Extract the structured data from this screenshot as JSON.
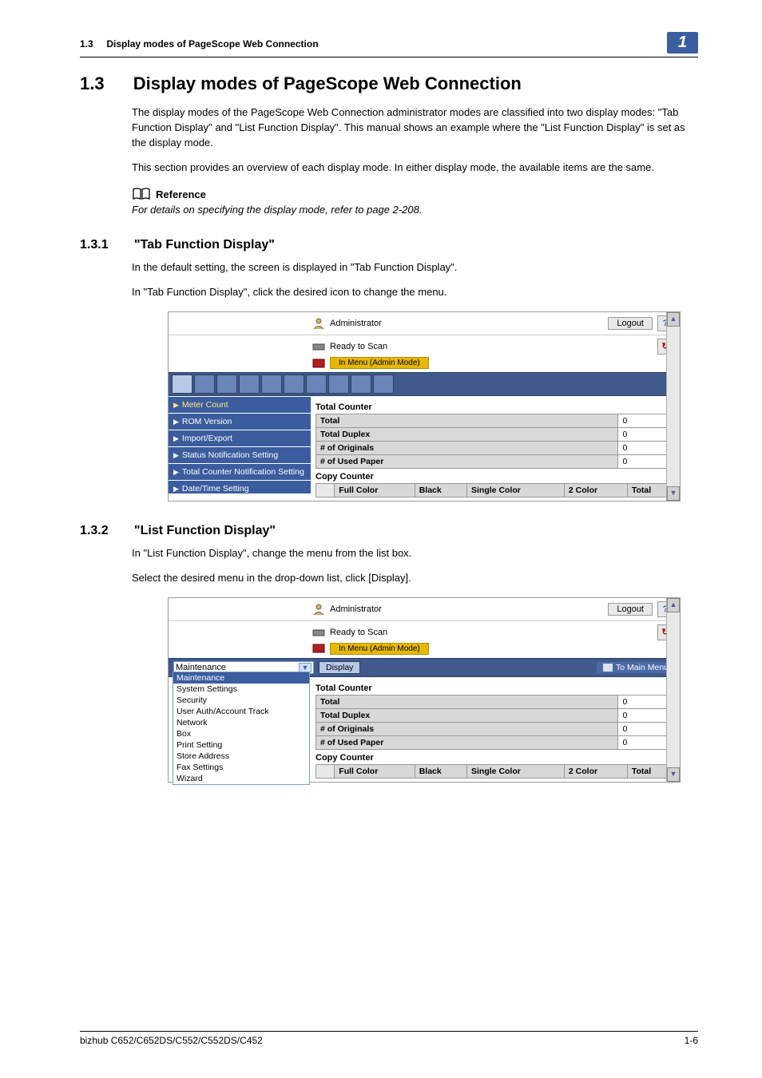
{
  "header": {
    "section_num_small": "1.3",
    "section_title_small": "Display modes of PageScope Web Connection",
    "chapter_badge": "1"
  },
  "section": {
    "num": "1.3",
    "title": "Display modes of PageScope Web Connection",
    "para1": "The display modes of the PageScope Web Connection administrator modes are classified into two display modes: \"Tab Function Display\" and \"List Function Display\". This manual shows an example where the \"List Function Display\" is set as the display mode.",
    "para2": "This section provides an overview of each display mode. In either display mode, the available items are the same.",
    "reference_label": "Reference",
    "reference_text": "For details on specifying the display mode, refer to page 2-208."
  },
  "sub1": {
    "num": "1.3.1",
    "title": "\"Tab Function Display\"",
    "p1": "In the default setting, the screen is displayed in \"Tab Function Display\".",
    "p2": "In \"Tab Function Display\", click the desired icon to change the menu."
  },
  "sub2": {
    "num": "1.3.2",
    "title": "\"List Function Display\"",
    "p1": "In \"List Function Display\", change the menu from the list box.",
    "p2": "Select the desired menu in the drop-down list, click [Display]."
  },
  "ss_common": {
    "admin_label": "Administrator",
    "logout": "Logout",
    "help": "?",
    "ready": "Ready to Scan",
    "in_menu": "In Menu (Admin Mode)",
    "refresh": "↻",
    "total_counter": "Total Counter",
    "rows": {
      "r1": {
        "label": "Total",
        "val": "0"
      },
      "r2": {
        "label": "Total Duplex",
        "val": "0"
      },
      "r3": {
        "label": "# of Originals",
        "val": "0"
      },
      "r4": {
        "label": "# of Used Paper",
        "val": "0"
      }
    },
    "copy_counter": "Copy Counter",
    "cols": {
      "c1": "Full Color",
      "c2": "Black",
      "c3": "Single Color",
      "c4": "2 Color",
      "c5": "Total"
    }
  },
  "ss1_nav": {
    "i1": "Meter Count",
    "i2": "ROM Version",
    "i3": "Import/Export",
    "i4": "Status Notification Setting",
    "i5": "Total Counter Notification Setting",
    "i6": "Date/Time Setting"
  },
  "ss2": {
    "select_value": "Maintenance",
    "display_btn": "Display",
    "to_main": "To Main Menu",
    "options": {
      "o1": "Maintenance",
      "o2": "System Settings",
      "o3": "Security",
      "o4": "User Auth/Account Track",
      "o5": "Network",
      "o6": "Box",
      "o7": "Print Setting",
      "o8": "Store Address",
      "o9": "Fax Settings",
      "o10": "Wizard"
    }
  },
  "footer": {
    "left": "bizhub C652/C652DS/C552/C552DS/C452",
    "right": "1-6"
  }
}
